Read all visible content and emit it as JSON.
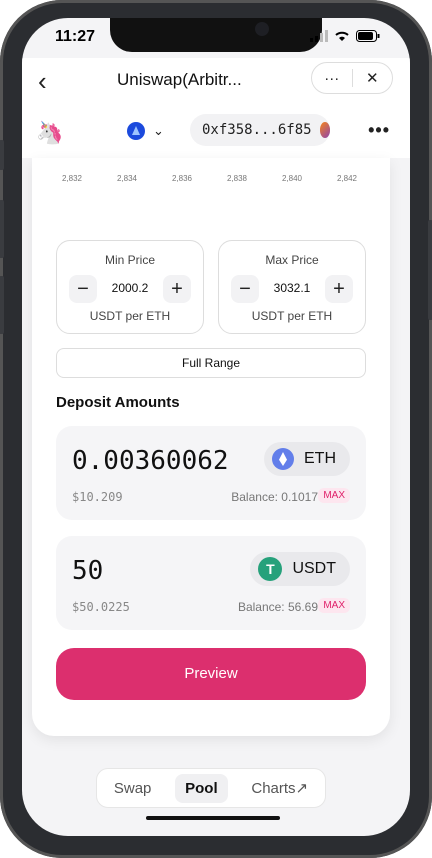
{
  "status": {
    "time": "11:27"
  },
  "topbar": {
    "back_icon": "chevron-left-icon",
    "title": "Uniswap(Arbitr...",
    "more_label": "···",
    "close_label": "✕"
  },
  "app": {
    "logo_icon": "unicorn-icon",
    "chain_icon": "arbitrum-icon",
    "address": "0xf358...6f85",
    "more_label": "•••"
  },
  "ticks": [
    "2,832",
    "2,834",
    "2,836",
    "2,838",
    "2,840",
    "2,842"
  ],
  "range": {
    "min": {
      "label": "Min Price",
      "value": "2000.2",
      "unit": "USDT per ETH"
    },
    "max": {
      "label": "Max Price",
      "value": "3032.1",
      "unit": "USDT per ETH"
    },
    "minus": "−",
    "plus": "+",
    "full_range": "Full Range"
  },
  "deposit": {
    "title": "Deposit Amounts",
    "token0": {
      "amount": "0.00360062",
      "symbol": "ETH",
      "usd": "$10.209",
      "balance": "Balance: 0.1017",
      "max": "MAX"
    },
    "token1": {
      "amount": "50",
      "symbol": "USDT",
      "usd": "$50.0225",
      "balance": "Balance: 56.69",
      "max": "MAX"
    }
  },
  "preview_label": "Preview",
  "nav": {
    "swap": "Swap",
    "pool": "Pool",
    "charts": "Charts↗"
  },
  "colors": {
    "accent": "#dc2f6e",
    "eth": "#627eea",
    "usdt": "#26a17b"
  }
}
